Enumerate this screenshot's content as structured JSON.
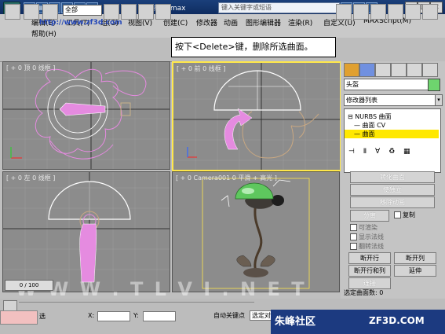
{
  "window": {
    "title": "机枪射手.max",
    "search_placeholder": "键入关键字或短语"
  },
  "menu": {
    "row1": [
      "编辑(E)",
      "工具(T)",
      "组(G)",
      "视图(V)",
      "创建(C)",
      "修改器",
      "动画",
      "图形编辑器",
      "渲染(R)",
      "自定义(U)",
      "MAXScript(M)"
    ],
    "row2": [
      "帮助(H)"
    ]
  },
  "toolbar": {
    "selection_filter": "全部"
  },
  "callout": {
    "text": "按下<Delete>键，删除所选曲面。"
  },
  "viewports": {
    "top": {
      "label": "[ + 0 顶 0 线框 ]"
    },
    "front": {
      "label": "[ + 0 前 0 线框 ]"
    },
    "left": {
      "label": "[ + 0 左 0 线框 ]"
    },
    "camera": {
      "label": "[ + 0 Camera001 0 平滑 + 高光 ]"
    }
  },
  "command_panel": {
    "object_name": "头盔",
    "object_color": "#6ed46e",
    "modifier_list": "修改器列表",
    "stack": [
      {
        "label": "NURBS 曲面",
        "selected": false
      },
      {
        "label": "曲面 CV",
        "selected": false
      },
      {
        "label": "曲面",
        "selected": true
      }
    ],
    "buttons": {
      "convert_surface": "转化曲面",
      "make_independent": "使独立",
      "remove_animation": "移除动画",
      "detach": "分离",
      "copy": "复制",
      "break_row": "断开行",
      "break_col": "断开列",
      "break_row_col": "断开行和列",
      "extend": "延伸",
      "join": "连接"
    },
    "checks": {
      "renderable": "可渲染",
      "display_normals": "显示法线",
      "flip_normals": "翻转法线"
    },
    "selected_count": "选定曲面数: 0"
  },
  "timeline": {
    "frame": "0 / 100"
  },
  "status": {
    "url_left": "http://www.zf3d.com",
    "autokey": "自动关键点",
    "selected_object": "选定对象",
    "x_label": "X:",
    "y_label": "Y:"
  },
  "branding": {
    "left": "朱峰社区",
    "right": "ZF3D.COM",
    "watermark": "W W W . T L V I . N E T"
  },
  "colors": {
    "active_viewport_border": "#ffe84a",
    "selection_pink": "#e58be0",
    "stack_highlight": "#ffe800"
  }
}
